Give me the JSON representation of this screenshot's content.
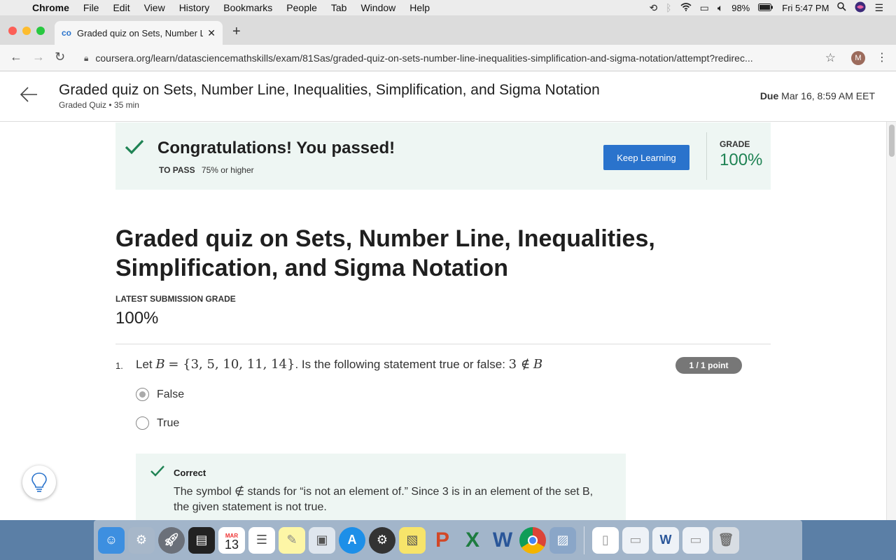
{
  "menubar": {
    "app": "Chrome",
    "items": [
      "File",
      "Edit",
      "View",
      "History",
      "Bookmarks",
      "People",
      "Tab",
      "Window",
      "Help"
    ],
    "battery": "98%",
    "clock": "Fri 5:47 PM"
  },
  "browser": {
    "tab_title": "Graded quiz on Sets, Number L",
    "url": "coursera.org/learn/datasciencemathskills/exam/81Sas/graded-quiz-on-sets-number-line-inequalities-simplification-and-sigma-notation/attempt?redirec...",
    "profile_initial": "M"
  },
  "header": {
    "title": "Graded quiz on Sets, Number Line, Inequalities, Simplification, and Sigma Notation",
    "subtitle": "Graded Quiz • 35 min",
    "due_label": "Due",
    "due_value": "Mar 16, 8:59 AM EET"
  },
  "banner": {
    "message": "Congratulations! You passed!",
    "to_pass_label": "TO PASS",
    "to_pass_value": "75% or higher",
    "button": "Keep Learning",
    "grade_label": "GRADE",
    "grade_value": "100%"
  },
  "quiz": {
    "title": "Graded quiz on Sets, Number Line, Inequalities, Simplification, and Sigma Notation",
    "latest_label": "LATEST SUBMISSION GRADE",
    "latest_value": "100%"
  },
  "question": {
    "number": "1.",
    "text_prefix": "Let",
    "math_set_name": "B",
    "math_eq": "= {3, 5, 10, 11, 14}",
    "text_mid": ". Is the following statement true or false:",
    "math_stmt_num": "3 ∉",
    "math_stmt_set": "B",
    "points": "1 / 1 point",
    "options": [
      {
        "label": "False",
        "selected": true
      },
      {
        "label": "True",
        "selected": false
      }
    ]
  },
  "feedback": {
    "label": "Correct",
    "text": "The symbol ∉ stands for “is not an element of.” Since 3 is in an element of the set B, the given statement is not true."
  },
  "colors": {
    "accent": "#2a73cc",
    "success": "#1f8354",
    "banner_bg": "#eef6f3"
  },
  "dock": {
    "calendar_month": "MAR",
    "calendar_day": "13"
  }
}
